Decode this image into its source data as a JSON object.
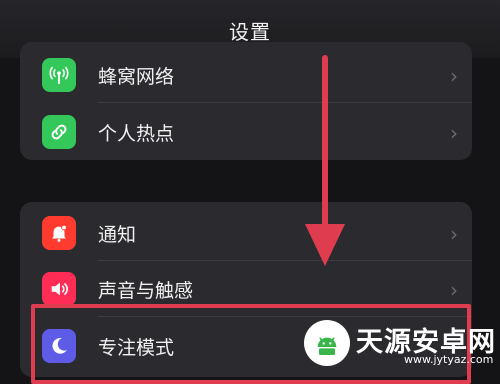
{
  "header": {
    "title": "设置"
  },
  "group1": {
    "items": [
      {
        "label": "蜂窝网络",
        "icon": "antenna-icon",
        "icon_color": "#34c759"
      },
      {
        "label": "个人热点",
        "icon": "link-chain-icon",
        "icon_color": "#34c759"
      }
    ]
  },
  "group2": {
    "items": [
      {
        "label": "通知",
        "icon": "bell-icon",
        "icon_color": "#ff3b30"
      },
      {
        "label": "声音与触感",
        "icon": "speaker-icon",
        "icon_color": "#ff2d55"
      },
      {
        "label": "专注模式",
        "icon": "moon-icon",
        "icon_color": "#5e5ce6"
      }
    ]
  },
  "annotation": {
    "color": "#e03c4f"
  },
  "watermark": {
    "title": "天源安卓网",
    "url": "www.jytyaz.com"
  }
}
